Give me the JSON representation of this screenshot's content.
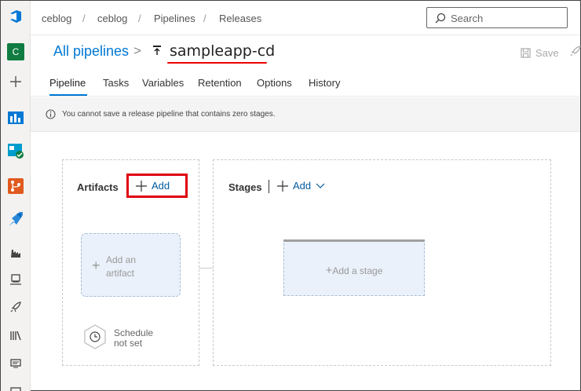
{
  "breadcrumb": {
    "org": "ceblog",
    "project": "ceblog",
    "section": "Pipelines",
    "page": "Releases",
    "separator": "/"
  },
  "search": {
    "placeholder": "Search"
  },
  "title": {
    "all_pipelines": "All pipelines",
    "chevron": ">",
    "pipeline_name": "sampleapp-cd"
  },
  "toolbar": {
    "save_label": "Save"
  },
  "tabs": [
    {
      "label": "Pipeline",
      "active": true
    },
    {
      "label": "Tasks"
    },
    {
      "label": "Variables"
    },
    {
      "label": "Retention"
    },
    {
      "label": "Options"
    },
    {
      "label": "History"
    }
  ],
  "info": {
    "message": "You cannot save a release pipeline that contains zero stages."
  },
  "artifacts": {
    "title": "Artifacts",
    "add_label": "Add",
    "card_line1": "Add an",
    "card_line2": "artifact",
    "schedule_line1": "Schedule",
    "schedule_line2": "not set"
  },
  "stages": {
    "title": "Stages",
    "add_label": "Add",
    "card_label": "Add a stage"
  },
  "rail": {
    "avatar_letter": "C"
  },
  "colors": {
    "accent": "#0078d4",
    "highlight": "#e00010",
    "avatar": "#107c41"
  }
}
